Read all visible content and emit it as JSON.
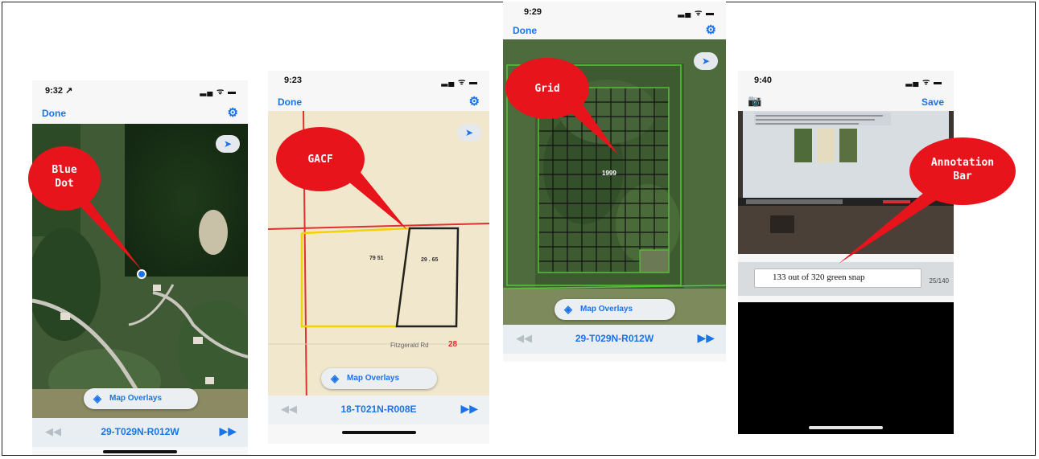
{
  "panels": [
    {
      "status_time": "9:32 ↗",
      "status_icons": "▂▄ ᯤ ▬",
      "nav_left": "Done",
      "nav_right_icon": "gear-icon",
      "locate_icon": "location-arrow-icon",
      "overlay_label": "Map Overlays",
      "section_label": "29-T029N-R012W",
      "prev_icon": "◀◀",
      "next_icon": "▶▶",
      "callout": "Blue\nDot"
    },
    {
      "status_time": "9:23",
      "status_icons": "▂▄ ᯤ ▬",
      "nav_left": "Done",
      "nav_right_icon": "gear-icon",
      "locate_icon": "location-arrow-icon",
      "overlay_label": "Map Overlays",
      "section_label": "18-T021N-R008E",
      "prev_icon": "◀◀",
      "next_icon": "▶▶",
      "parcel_a": "79 51",
      "parcel_b": "29 . 65",
      "road_label": "Fitzgerald Rd",
      "road_number": "28",
      "callout": "GACF"
    },
    {
      "status_time": "9:29",
      "status_icons": "▂▄ ᯤ ▬",
      "nav_left": "Done",
      "nav_right_icon": "gear-icon",
      "locate_icon": "location-arrow-icon",
      "overlay_label": "Map Overlays",
      "section_label": "29-T029N-R012W",
      "prev_icon": "◀◀",
      "next_icon": "▶▶",
      "grid_value": "1999",
      "callout": "Grid"
    },
    {
      "status_time": "9:40",
      "status_icons": "▂▄ ᯤ ▬",
      "nav_left_icon": "camera-icon",
      "nav_right": "Save",
      "annotation_value": "133 out of 320 green snap",
      "counter": "25/140",
      "callout": "Annotation\nBar"
    }
  ],
  "colors": {
    "callout_red": "#e8141c",
    "ios_blue": "#1a73e8",
    "grid_green": "#58c43a",
    "parcel_yellow": "#f2d200",
    "road_red": "#e03030"
  }
}
